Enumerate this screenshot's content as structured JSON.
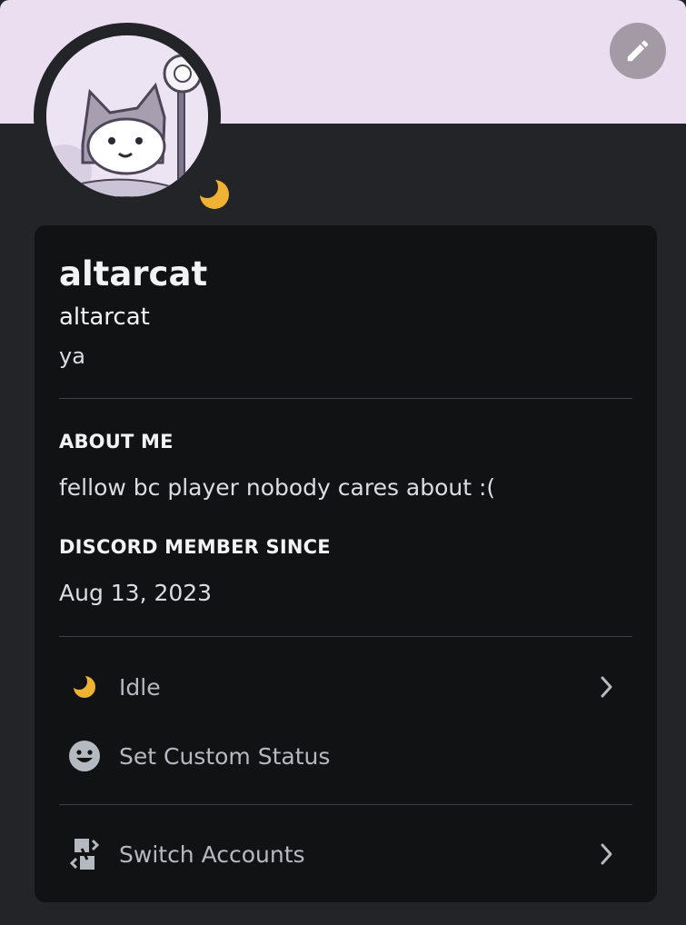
{
  "profile": {
    "display_name": "altarcat",
    "username": "altarcat",
    "pronouns": "ya"
  },
  "about_me": {
    "title": "ABOUT ME",
    "text": "fellow bc player nobody cares about :("
  },
  "member_since": {
    "title": "DISCORD MEMBER SINCE",
    "date": "Aug 13, 2023"
  },
  "menu": {
    "status_label": "Idle",
    "custom_status_label": "Set Custom Status",
    "switch_accounts_label": "Switch Accounts"
  },
  "colors": {
    "banner": "#ebdef0",
    "card": "#111214",
    "idle": "#f0b232"
  },
  "icons": {
    "edit": "pencil-icon",
    "status": "idle-moon-icon",
    "custom_status": "smiley-icon",
    "switch_accounts": "switch-accounts-icon"
  }
}
